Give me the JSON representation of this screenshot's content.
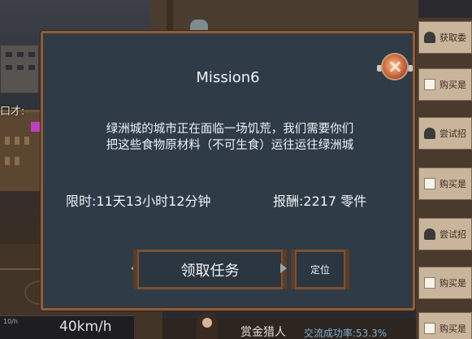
{
  "scene": {
    "side_label": "口才:",
    "speed_unit_small": "10/h",
    "speed": "40km/h"
  },
  "right_panel": {
    "items": [
      {
        "label": "获取委",
        "icon": "person-icon"
      },
      {
        "label": "购买是",
        "icon": "document-icon"
      },
      {
        "label": "尝试招",
        "icon": "person-icon"
      },
      {
        "label": "购买是",
        "icon": "document-icon"
      },
      {
        "label": "尝试招",
        "icon": "person-icon"
      },
      {
        "label": "购买是",
        "icon": "document-icon"
      },
      {
        "label": "购买是",
        "icon": "document-icon"
      }
    ]
  },
  "bottom": {
    "hunter_name": "赏金猎人",
    "rate_label": "交流成功率:",
    "rate_value": "53.3%"
  },
  "dialog": {
    "title": "Mission6",
    "description_line1": "绿洲城的城市正在面临一场饥荒，我们需要你们",
    "description_line2": "把这些食物原材料（不可生食）运往运往绿洲城",
    "time_limit": "限时:11天13小时12分钟",
    "reward": "报酬:2217 零件",
    "accept_button": "领取任务",
    "locate_button": "定位"
  },
  "colors": {
    "dialog_bg": "#2f3b47",
    "dialog_border": "#8a5f3f",
    "button_border": "#7a5234",
    "rate_color": "#7fb3d8"
  }
}
